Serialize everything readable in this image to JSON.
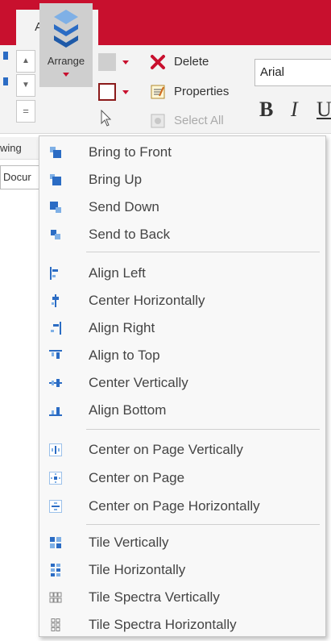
{
  "ribbon": {
    "tab_label": "Analysis",
    "arrange_label": "Arrange",
    "delete_label": "Delete",
    "properties_label": "Properties",
    "select_all_label": "Select All",
    "font_name": "Arial",
    "bold_glyph": "B",
    "italic_glyph": "I",
    "underline_glyph": "U"
  },
  "background": {
    "row_label_1": "wing",
    "row_label_2": "Docur"
  },
  "menu": {
    "groups": [
      [
        "Bring to Front",
        "Bring Up",
        "Send Down",
        "Send to Back"
      ],
      [
        "Align Left",
        "Center Horizontally",
        "Align Right",
        "Align to Top",
        "Center Vertically",
        "Align Bottom"
      ],
      [
        "Center on Page Vertically",
        "Center on Page",
        "Center on Page Horizontally"
      ],
      [
        "Tile Vertically",
        "Tile Horizontally",
        "Tile Spectra Vertically",
        "Tile Spectra Horizontally"
      ]
    ]
  },
  "colors": {
    "accent_red": "#c8102e",
    "icon_blue": "#2b6cc4",
    "icon_light_blue": "#7fb0e6"
  }
}
